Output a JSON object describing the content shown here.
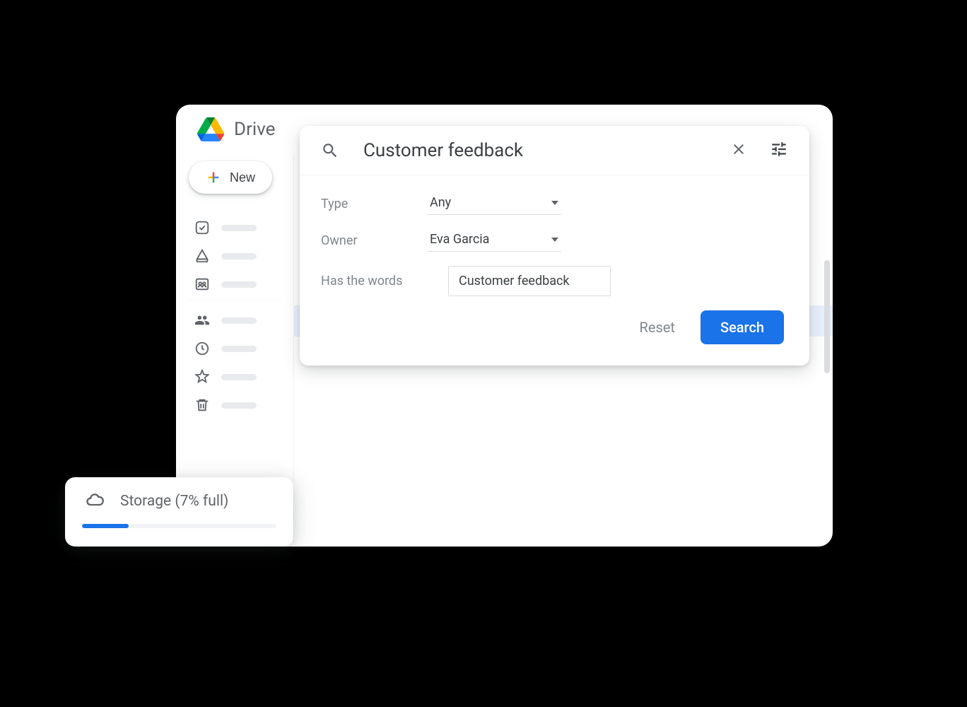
{
  "app": {
    "title": "Drive"
  },
  "new_button": {
    "label": "New"
  },
  "search": {
    "query": "Customer feedback",
    "filters": {
      "type": {
        "label": "Type",
        "value": "Any"
      },
      "owner": {
        "label": "Owner",
        "value": "Eva Garcia"
      },
      "has_words": {
        "label": "Has the words",
        "value": "Customer feedback"
      }
    },
    "actions": {
      "reset": "Reset",
      "search": "Search"
    }
  },
  "storage": {
    "label": "Storage (7% full)",
    "percent": 7,
    "fill_width": "24%"
  }
}
